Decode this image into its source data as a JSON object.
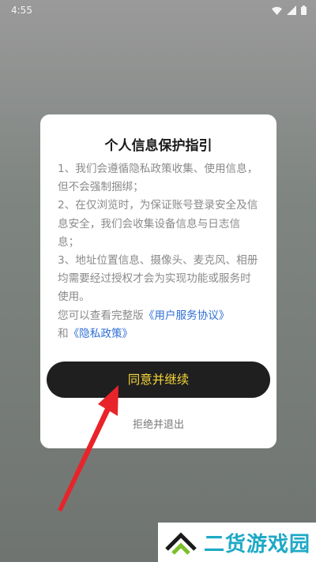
{
  "status_bar": {
    "time": "4:55",
    "icons": [
      "wifi-icon",
      "signal-icon",
      "battery-icon"
    ]
  },
  "dialog": {
    "title": "个人信息保护指引",
    "items": [
      "1、我们会遵循隐私政策收集、使用信息，但不会强制捆绑；",
      "2、在仅浏览时，为保证账号登录安全及信息安全，我们会收集设备信息与日志信息；",
      "3、地址位置信息、摄像头、麦克风、相册均需要经过授权才会为实现功能或服务时使用。"
    ],
    "view_prefix": "您可以查看完整版",
    "user_agreement_link": "《用户服务协议》",
    "and_text": "和",
    "privacy_policy_link": "《隐私政策》",
    "agree_button": "同意并继续",
    "decline_button": "拒绝并退出"
  },
  "watermark": {
    "text": "二货游戏园"
  },
  "colors": {
    "link": "#2f6fd6",
    "agree_button_bg": "#1f1f1f",
    "agree_button_text": "#f4d53a",
    "annotation_arrow": "#e8242a",
    "watermark_text": "#1ea9c6"
  }
}
